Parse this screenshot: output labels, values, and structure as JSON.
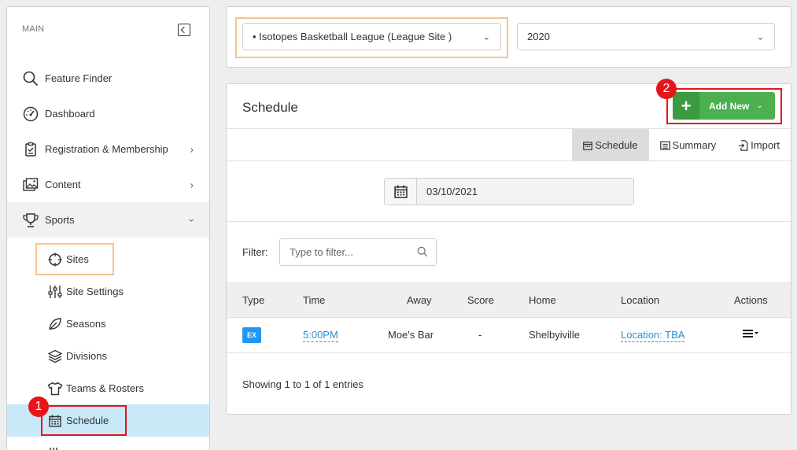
{
  "sidebar": {
    "section_label": "MAIN",
    "items": [
      {
        "label": "Feature Finder",
        "icon": "search-icon"
      },
      {
        "label": "Dashboard",
        "icon": "dashboard-gauge-icon"
      },
      {
        "label": "Registration & Membership",
        "icon": "clipboard-icon",
        "has_children": true
      },
      {
        "label": "Content",
        "icon": "images-icon",
        "has_children": true
      },
      {
        "label": "Sports",
        "icon": "trophy-icon",
        "expanded": true
      }
    ],
    "sub_items": [
      {
        "label": "Sites",
        "icon": "crosshair-icon"
      },
      {
        "label": "Site Settings",
        "icon": "sliders-icon"
      },
      {
        "label": "Seasons",
        "icon": "leaf-icon"
      },
      {
        "label": "Divisions",
        "icon": "layers-icon"
      },
      {
        "label": "Teams & Rosters",
        "icon": "shirt-icon"
      },
      {
        "label": "Schedule",
        "icon": "calendar-icon",
        "active": true
      }
    ]
  },
  "callouts": {
    "one": "1",
    "two": "2"
  },
  "selectors": {
    "league": "• Isotopes Basketball League (League Site )",
    "year": "2020"
  },
  "schedule": {
    "title": "Schedule",
    "add_new_label": "Add New",
    "tabs": [
      {
        "label": "Schedule",
        "icon": "calendar-icon",
        "active": true
      },
      {
        "label": "Summary",
        "icon": "list-icon"
      },
      {
        "label": "Import",
        "icon": "import-icon"
      }
    ],
    "date": "03/10/2021",
    "filter_label": "Filter:",
    "filter_placeholder": "Type to filter...",
    "columns": [
      "Type",
      "Time",
      "Away",
      "Score",
      "Home",
      "Location",
      "Actions"
    ],
    "rows": [
      {
        "type": "EX",
        "time": "5:00PM",
        "away": "Moe's Bar",
        "score": "-",
        "home": "Shelbyiville",
        "location": "Location: TBA"
      }
    ],
    "showing": "Showing 1 to 1 of 1 entries"
  },
  "colors": {
    "accent_green": "#4caf50",
    "highlight_orange": "#f3c58e",
    "highlight_red": "#e8141a",
    "active_row": "#c9e9f8",
    "link_blue": "#2a8fd4"
  }
}
